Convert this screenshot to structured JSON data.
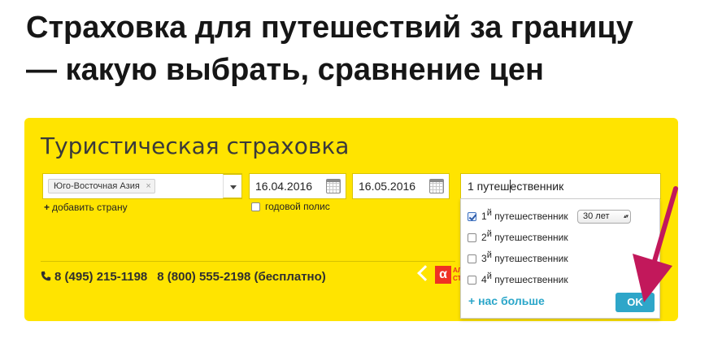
{
  "page": {
    "title_line1": "Страховка для путешествий за границу",
    "title_line2": "— какую выбрать, сравнение цен"
  },
  "widget": {
    "title": "Туристическая страховка",
    "country_tag": "Юго-Восточная Азия",
    "country_tag_remove": "×",
    "add_country": "добавить страну",
    "date_from": "16.04.2016",
    "date_to": "16.05.2016",
    "yearly_policy": "годовой полис",
    "travelers_value_before_caret": "1 путеш",
    "travelers_value_after_caret": "ественник",
    "phone1": "8 (495) 215-1198",
    "phone2": "8 (800) 555-2198 (бесплатно)",
    "brand_logo": "α"
  },
  "popup": {
    "travelers": [
      {
        "num": "1",
        "sup": "й",
        "label": "путешественник",
        "checked": true,
        "age": "30 лет"
      },
      {
        "num": "2",
        "sup": "й",
        "label": "путешественник",
        "checked": false
      },
      {
        "num": "3",
        "sup": "й",
        "label": "путешественник",
        "checked": false
      },
      {
        "num": "4",
        "sup": "й",
        "label": "путешественник",
        "checked": false
      }
    ],
    "more_link": "+ нас больше",
    "ok_label": "OK"
  },
  "colors": {
    "widget_bg": "#ffe400",
    "accent_blue": "#2ea6c9",
    "arrow": "#c2185b",
    "brand_red": "#ef3124"
  }
}
